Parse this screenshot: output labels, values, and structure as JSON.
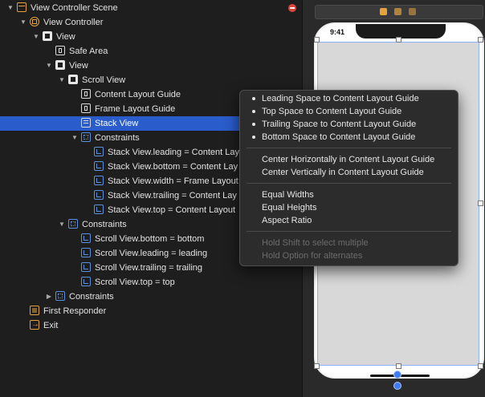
{
  "outline": {
    "rows": [
      {
        "label": "View Controller Scene",
        "level": 0,
        "icon": "scene-icon",
        "expand": "open"
      },
      {
        "label": "View Controller",
        "level": 1,
        "icon": "view-controller-icon",
        "expand": "open"
      },
      {
        "label": "View",
        "level": 2,
        "icon": "view-icon",
        "expand": "open"
      },
      {
        "label": "Safe Area",
        "level": 3,
        "icon": "layout-guide-icon",
        "expand": "none"
      },
      {
        "label": "View",
        "level": 3,
        "icon": "view-icon",
        "expand": "open"
      },
      {
        "label": "Scroll View",
        "level": 4,
        "icon": "scroll-view-icon",
        "expand": "open"
      },
      {
        "label": "Content Layout Guide",
        "level": 5,
        "icon": "layout-guide-icon",
        "expand": "none"
      },
      {
        "label": "Frame Layout Guide",
        "level": 5,
        "icon": "layout-guide-icon",
        "expand": "none"
      },
      {
        "label": "Stack View",
        "level": 5,
        "icon": "stack-view-icon",
        "expand": "none",
        "selected": true
      },
      {
        "label": "Constraints",
        "level": 5,
        "icon": "constraints-icon",
        "expand": "open"
      },
      {
        "label": "Stack View.leading = Content Lay",
        "level": 6,
        "icon": "constraint-icon",
        "expand": "none"
      },
      {
        "label": "Stack View.bottom = Content Lay",
        "level": 6,
        "icon": "constraint-icon",
        "expand": "none"
      },
      {
        "label": "Stack View.width = Frame Layout",
        "level": 6,
        "icon": "constraint-icon",
        "expand": "none"
      },
      {
        "label": "Stack View.trailing = Content Lay",
        "level": 6,
        "icon": "constraint-icon",
        "expand": "none"
      },
      {
        "label": "Stack View.top = Content Layout",
        "level": 6,
        "icon": "constraint-icon",
        "expand": "none"
      },
      {
        "label": "Constraints",
        "level": 4,
        "icon": "constraints-icon",
        "expand": "open"
      },
      {
        "label": "Scroll View.bottom = bottom",
        "level": 5,
        "icon": "constraint-icon",
        "expand": "none"
      },
      {
        "label": "Scroll View.leading = leading",
        "level": 5,
        "icon": "constraint-icon",
        "expand": "none"
      },
      {
        "label": "Scroll View.trailing = trailing",
        "level": 5,
        "icon": "constraint-icon",
        "expand": "none"
      },
      {
        "label": "Scroll View.top = top",
        "level": 5,
        "icon": "constraint-icon",
        "expand": "none"
      },
      {
        "label": "Constraints",
        "level": 3,
        "icon": "constraints-icon",
        "expand": "closed"
      },
      {
        "label": "First Responder",
        "level": 1,
        "icon": "first-responder-icon",
        "expand": "none"
      },
      {
        "label": "Exit",
        "level": 1,
        "icon": "exit-icon",
        "expand": "none"
      }
    ]
  },
  "canvas": {
    "status_time": "9:41"
  },
  "context_menu": {
    "groups": [
      [
        {
          "label": "Leading Space to Content Layout Guide",
          "bullet": true
        },
        {
          "label": "Top Space to Content Layout Guide",
          "bullet": true
        },
        {
          "label": "Trailing Space to Content Layout Guide",
          "bullet": true
        },
        {
          "label": "Bottom Space to Content Layout Guide",
          "bullet": true
        }
      ],
      [
        {
          "label": "Center Horizontally in Content Layout Guide",
          "bullet": false
        },
        {
          "label": "Center Vertically in Content Layout Guide",
          "bullet": false
        }
      ],
      [
        {
          "label": "Equal Widths",
          "bullet": false
        },
        {
          "label": "Equal Heights",
          "bullet": false
        },
        {
          "label": "Aspect Ratio",
          "bullet": false
        }
      ],
      [
        {
          "label": "Hold Shift to select multiple",
          "bullet": false,
          "disabled": true
        },
        {
          "label": "Hold Option for alternates",
          "bullet": false,
          "disabled": true
        }
      ]
    ]
  },
  "colors": {
    "selection": "#2a5ccb",
    "accent_orange": "#e6a23c",
    "constraint_blue": "#5b8fe0",
    "error_red": "#e0433a"
  }
}
